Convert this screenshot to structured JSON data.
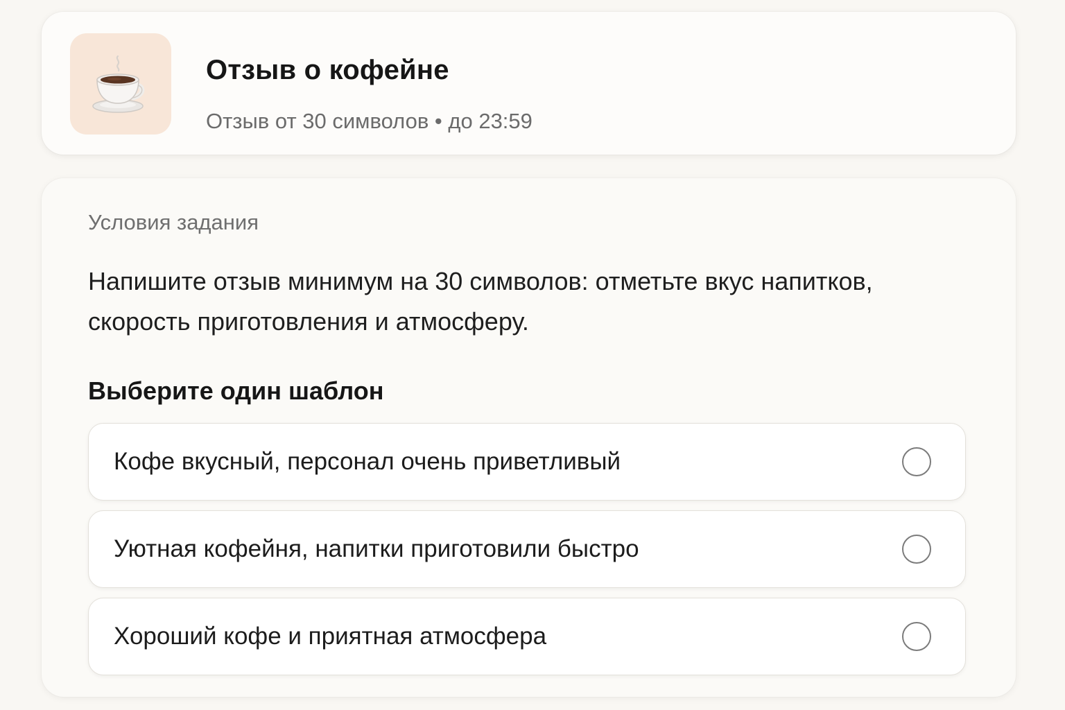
{
  "header": {
    "icon": "coffee-cup-icon",
    "title": "Отзыв о кофейне",
    "subtitle": "Отзыв от 30 символов • до 23:59"
  },
  "task": {
    "section_label": "Условия задания",
    "description": "Напишите отзыв минимум на 30 символов:  отметьте вкус напитков, скорость приготовления и атмосферу.",
    "choose_label": "Выберите один шаблон",
    "options": [
      {
        "label": "Кофе вкусный, персонал очень приветливый",
        "selected": false
      },
      {
        "label": "Уютная кофейня, напитки приготовили быстро",
        "selected": false
      },
      {
        "label": "Хороший кофе и приятная атмосфера",
        "selected": false
      }
    ]
  },
  "colors": {
    "background": "#f9f7f3",
    "card": "#fdfcfa",
    "icon_tile": "#f8e6d8",
    "muted_text": "#6b6b6b",
    "radio_border": "#7b7b7b"
  }
}
